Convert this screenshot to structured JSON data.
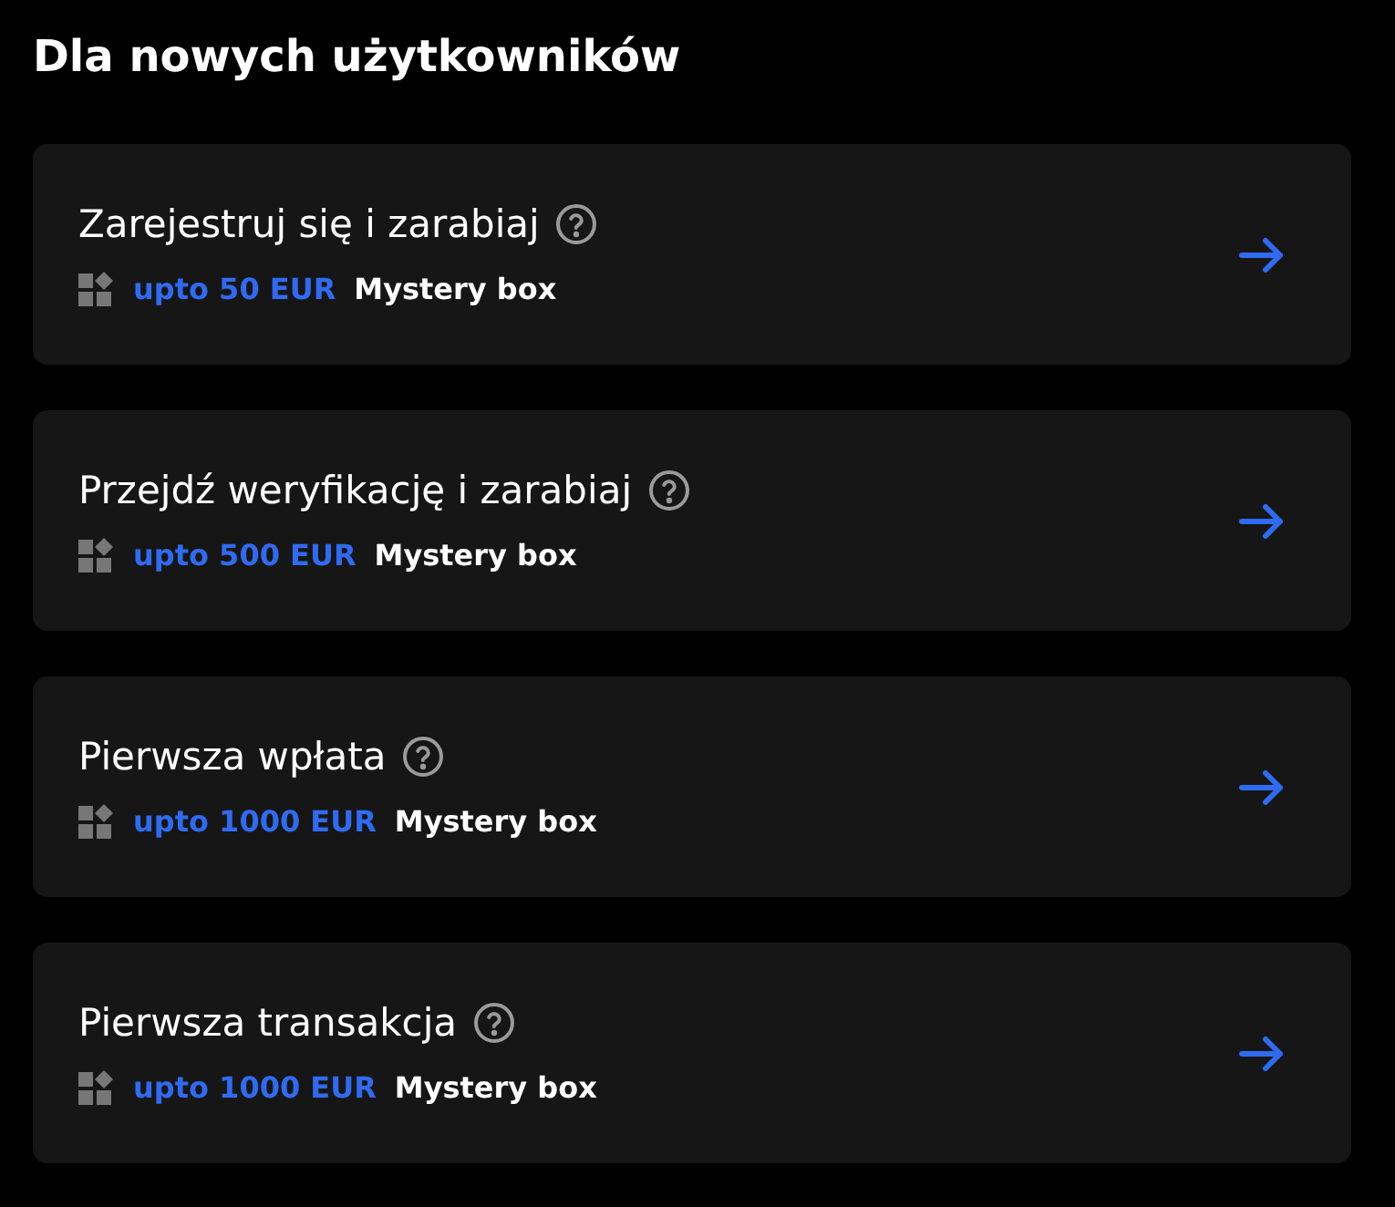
{
  "heading": "Dla nowych użytkowników",
  "tasks": [
    {
      "title": "Zarejestruj się i zarabiaj",
      "amount": "upto 50 EUR",
      "reward": "Mystery box"
    },
    {
      "title": "Przejdź weryfikację i zarabiaj",
      "amount": "upto 500 EUR",
      "reward": "Mystery box"
    },
    {
      "title": "Pierwsza wpłata",
      "amount": "upto 1000 EUR",
      "reward": "Mystery box"
    },
    {
      "title": "Pierwsza transakcja",
      "amount": "upto 1000 EUR",
      "reward": "Mystery box"
    }
  ]
}
